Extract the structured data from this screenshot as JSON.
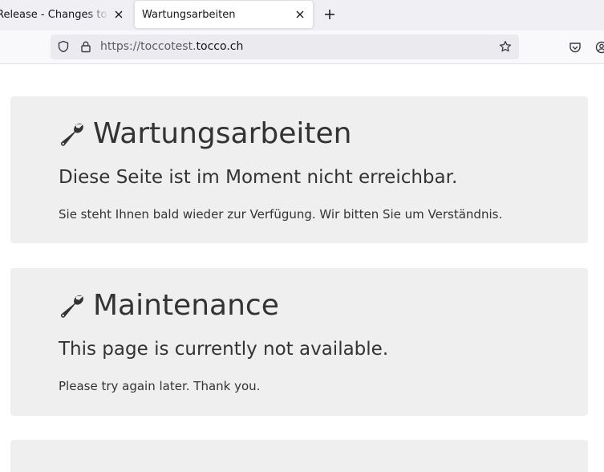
{
  "browser": {
    "tabs": [
      {
        "title": "Release - Changes to Code",
        "active": false
      },
      {
        "title": "Wartungsarbeiten",
        "active": true
      }
    ],
    "url": {
      "prefix": "https://toccotest.",
      "domain": "tocco.ch"
    },
    "icons": [
      "shield-icon",
      "lock-icon",
      "star-icon",
      "pocket-icon",
      "account-icon",
      "close-icon",
      "plus-icon"
    ]
  },
  "page": {
    "panels": [
      {
        "title": "Wartungsarbeiten",
        "subtitle": "Diese Seite ist im Moment nicht erreichbar.",
        "text": "Sie steht Ihnen bald wieder zur Verfügung. Wir bitten Sie um Verständnis."
      },
      {
        "title": "Maintenance",
        "subtitle": "This page is currently not available.",
        "text": "Please try again later. Thank you."
      }
    ],
    "colors": {
      "panel_bg": "#efefef",
      "text": "#333333"
    }
  }
}
